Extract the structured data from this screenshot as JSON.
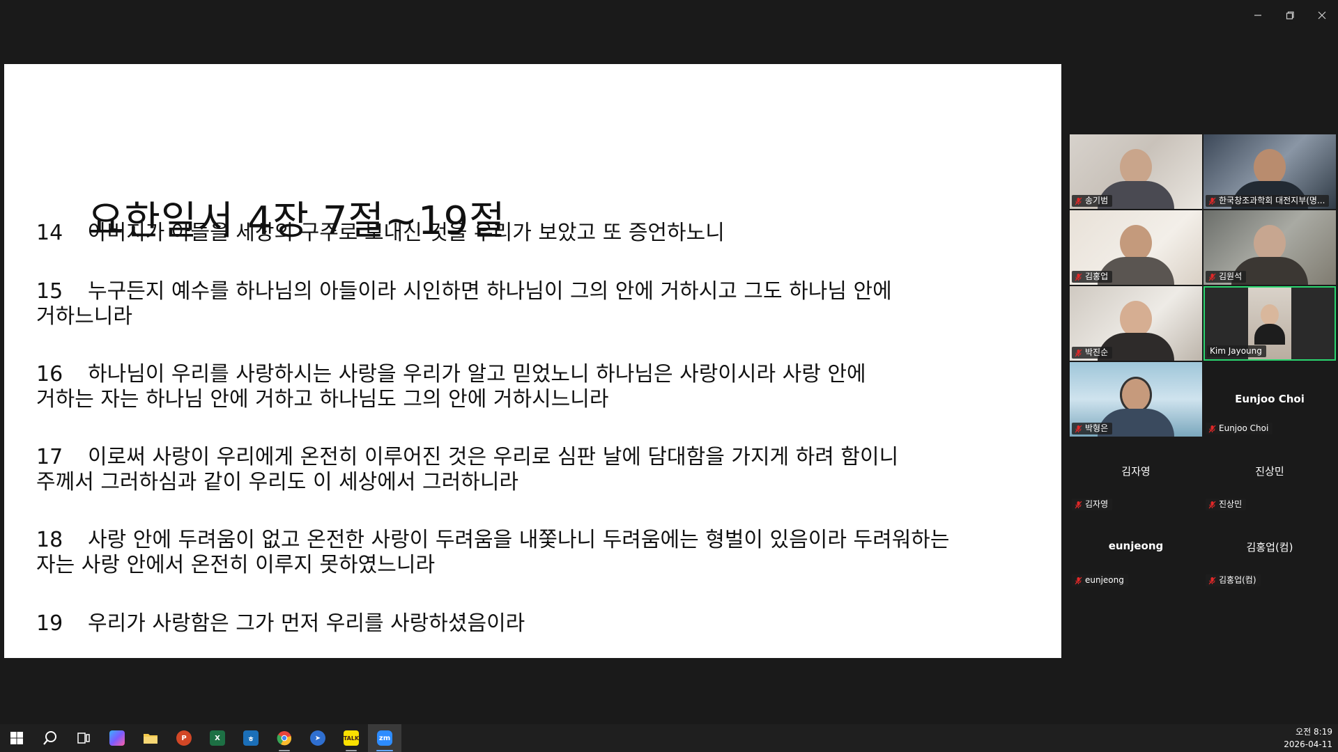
{
  "window": {
    "minimize_icon": "minimize-icon",
    "restore_icon": "restore-icon",
    "close_icon": "close-icon"
  },
  "slide": {
    "title": "요한일서 4장 7절~19절",
    "verses": [
      {
        "num": "14",
        "text": "아버지가 아들을 세상의 구주로 보내신 것을 우리가 보았고 또 증언하노니"
      },
      {
        "num": "15",
        "text": "누구든지 예수를 하나님의 아들이라 시인하면 하나님이 그의 안에 거하시고 그도 하나님 안에",
        "cont": "거하느니라"
      },
      {
        "num": "16",
        "text": "하나님이 우리를 사랑하시는 사랑을 우리가 알고 믿었노니 하나님은 사랑이시라 사랑 안에",
        "cont": "거하는 자는 하나님 안에 거하고 하나님도 그의 안에 거하시느니라"
      },
      {
        "num": "17",
        "text": "이로써 사랑이 우리에게 온전히 이루어진 것은 우리로 심판 날에 담대함을 가지게 하려 함이니",
        "cont": "주께서 그러하심과 같이 우리도 이 세상에서 그러하니라"
      },
      {
        "num": "18",
        "text": "사랑 안에 두려움이 없고 온전한 사랑이 두려움을 내쫓나니 두려움에는 형벌이 있음이라 두려워하는",
        "cont": "자는 사랑 안에서 온전히 이루지 못하였느니라"
      },
      {
        "num": "19",
        "text": "우리가 사랑함은 그가 먼저 우리를 사랑하셨음이라"
      }
    ]
  },
  "participants": [
    {
      "name": "송기범",
      "muted": true
    },
    {
      "name": "한국창조과학회 대전지부(명...",
      "muted": true
    },
    {
      "name": "김홍업",
      "muted": true
    },
    {
      "name": "김원석",
      "muted": true
    },
    {
      "name": "박진순",
      "muted": true
    },
    {
      "name": "Kim Jayoung",
      "muted": false
    },
    {
      "name": "박형은",
      "muted": true
    },
    {
      "name": "Eunjoo Choi",
      "display": "Eunjoo Choi",
      "muted": true
    },
    {
      "name": "김자영",
      "display": "김자영",
      "muted": true
    },
    {
      "name": "진상민",
      "display": "진상민",
      "muted": true
    },
    {
      "name": "eunjeong",
      "display": "eunjeong",
      "muted": true
    },
    {
      "name": "김홍업(컴)",
      "display": "김홍업(컴)",
      "muted": true
    }
  ],
  "taskbar": {
    "apps": [
      {
        "name": "start-icon",
        "color": "#ffffff"
      },
      {
        "name": "search-icon",
        "color": "#ffffff"
      },
      {
        "name": "task-view-icon",
        "color": "#ffffff"
      },
      {
        "name": "copilot-icon",
        "color": "#7b5cff"
      },
      {
        "name": "file-explorer-icon",
        "color": "#f2c94c"
      },
      {
        "name": "powerpoint-icon",
        "color": "#d24726"
      },
      {
        "name": "excel-icon",
        "color": "#1d7044"
      },
      {
        "name": "hangul-icon",
        "color": "#1b6fb8"
      },
      {
        "name": "chrome-icon",
        "color": "#e8453c"
      },
      {
        "name": "app-icon",
        "color": "#2f6fd0"
      },
      {
        "name": "kakaotalk-icon",
        "color": "#f9e000",
        "label": "TALK"
      },
      {
        "name": "zoom-icon",
        "color": "#2d8cff",
        "label": "zm"
      }
    ],
    "clock": {
      "time": "오전 8:19",
      "date": "2026-04-11"
    }
  }
}
